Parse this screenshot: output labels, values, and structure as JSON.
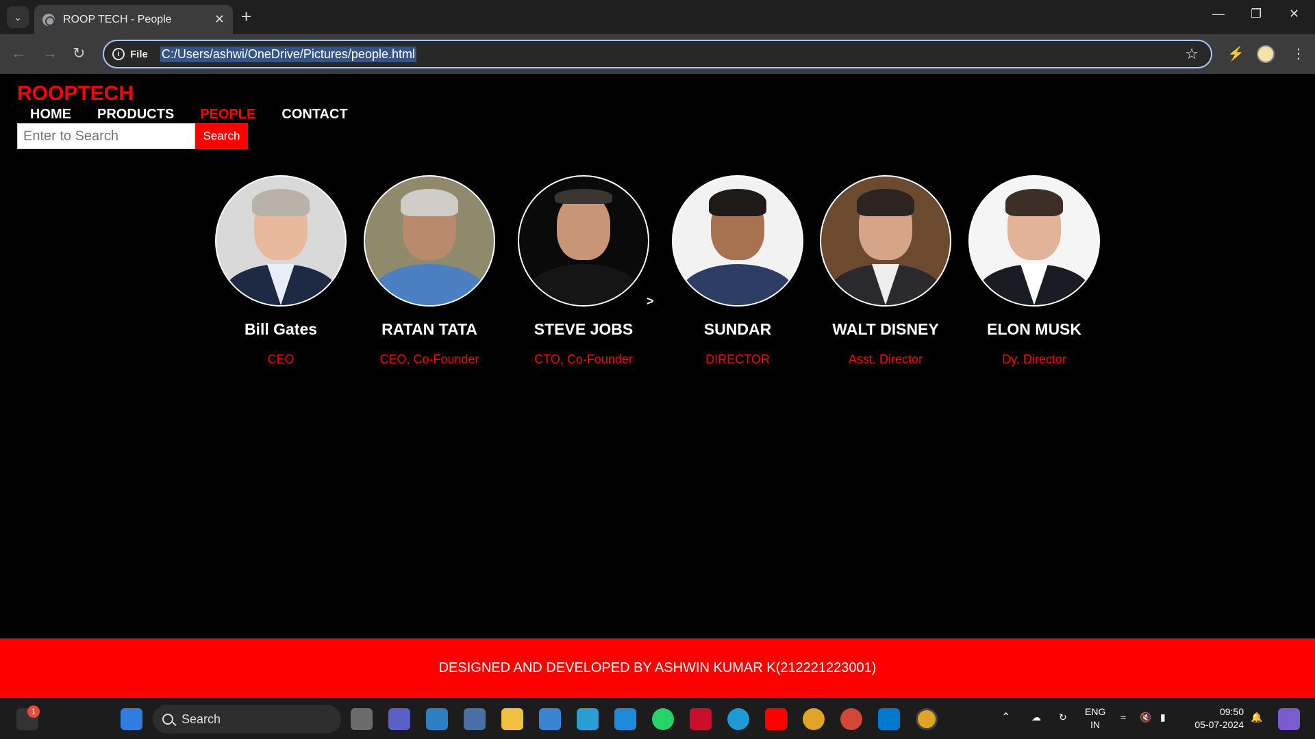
{
  "browser": {
    "tab_title": "ROOP TECH - People",
    "file_label": "File",
    "url": "C:/Users/ashwi/OneDrive/Pictures/people.html"
  },
  "site": {
    "brand": "ROOPTECH",
    "nav": [
      {
        "label": "HOME",
        "active": false
      },
      {
        "label": "PRODUCTS",
        "active": false
      },
      {
        "label": "PEOPLE",
        "active": true
      },
      {
        "label": "CONTACT",
        "active": false
      }
    ],
    "search_placeholder": "Enter to Search",
    "search_button": "Search",
    "arrow": ">",
    "people": [
      {
        "name": "Bill Gates",
        "role": "CEO"
      },
      {
        "name": "RATAN TATA",
        "role": "CEO, Co-Founder"
      },
      {
        "name": "STEVE JOBS",
        "role": "CTO, Co-Founder"
      },
      {
        "name": "SUNDAR",
        "role": "DIRECTOR"
      },
      {
        "name": "WALT DISNEY",
        "role": "Asst. Director"
      },
      {
        "name": "ELON MUSK",
        "role": "Dy. Director"
      }
    ],
    "footer": "DESIGNED AND DEVELOPED BY ASHWIN KUMAR K(212221223001)"
  },
  "taskbar": {
    "search_label": "Search",
    "notification_count": "1",
    "lang_line1": "ENG",
    "lang_line2": "IN",
    "time": "09:50",
    "date": "05-07-2024"
  }
}
